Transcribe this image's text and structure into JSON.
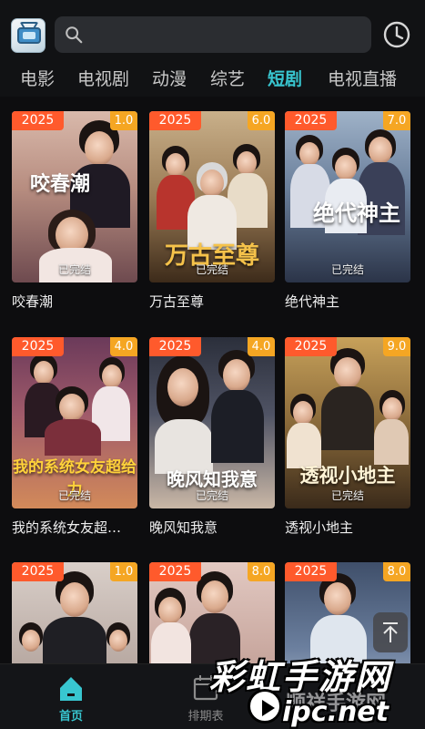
{
  "header": {
    "logo_icon": "tv-app-logo-icon",
    "search": {
      "placeholder": "",
      "icon": "search-icon"
    },
    "history_icon": "clock-history-icon"
  },
  "tabs": [
    {
      "label": "电影",
      "active": false
    },
    {
      "label": "电视剧",
      "active": false
    },
    {
      "label": "动漫",
      "active": false
    },
    {
      "label": "综艺",
      "active": false
    },
    {
      "label": "短剧",
      "active": true
    },
    {
      "label": "电视直播",
      "active": false
    }
  ],
  "cards": [
    {
      "year": "2025",
      "score": "1.0",
      "status": "已完结",
      "title": "咬春潮",
      "poster_text": "咬春潮"
    },
    {
      "year": "2025",
      "score": "6.0",
      "status": "已完结",
      "title": "万古至尊",
      "poster_text": "万古至尊"
    },
    {
      "year": "2025",
      "score": "7.0",
      "status": "已完结",
      "title": "绝代神主",
      "poster_text": "绝代神主"
    },
    {
      "year": "2025",
      "score": "4.0",
      "status": "已完结",
      "title": "我的系统女友超…",
      "poster_text": "我的系统女友超给力"
    },
    {
      "year": "2025",
      "score": "4.0",
      "status": "已完结",
      "title": "晚风知我意",
      "poster_text": "晚风知我意"
    },
    {
      "year": "2025",
      "score": "9.0",
      "status": "已完结",
      "title": "透视小地主",
      "poster_text": "透视小地主"
    },
    {
      "year": "2025",
      "score": "1.0",
      "status": "",
      "title": "",
      "poster_text": ""
    },
    {
      "year": "2025",
      "score": "8.0",
      "status": "",
      "title": "",
      "poster_text": ""
    },
    {
      "year": "2025",
      "score": "8.0",
      "status": "",
      "title": "",
      "poster_text": ""
    }
  ],
  "scroll_top_icon": "arrow-up-icon",
  "bottom_nav": {
    "home": {
      "label": "首页",
      "icon": "home-icon",
      "active": true
    },
    "schedule": {
      "label": "排期表",
      "icon": "calendar-icon",
      "active": false
    }
  },
  "watermark": {
    "main": "彩虹手游网",
    "sub": "顺祥手游网",
    "domain": "ipc.net"
  },
  "colors": {
    "accent": "#38c6d0",
    "year_badge": "#ff5a2c",
    "score_badge": "#f5a623",
    "background": "#0d0d0f"
  }
}
